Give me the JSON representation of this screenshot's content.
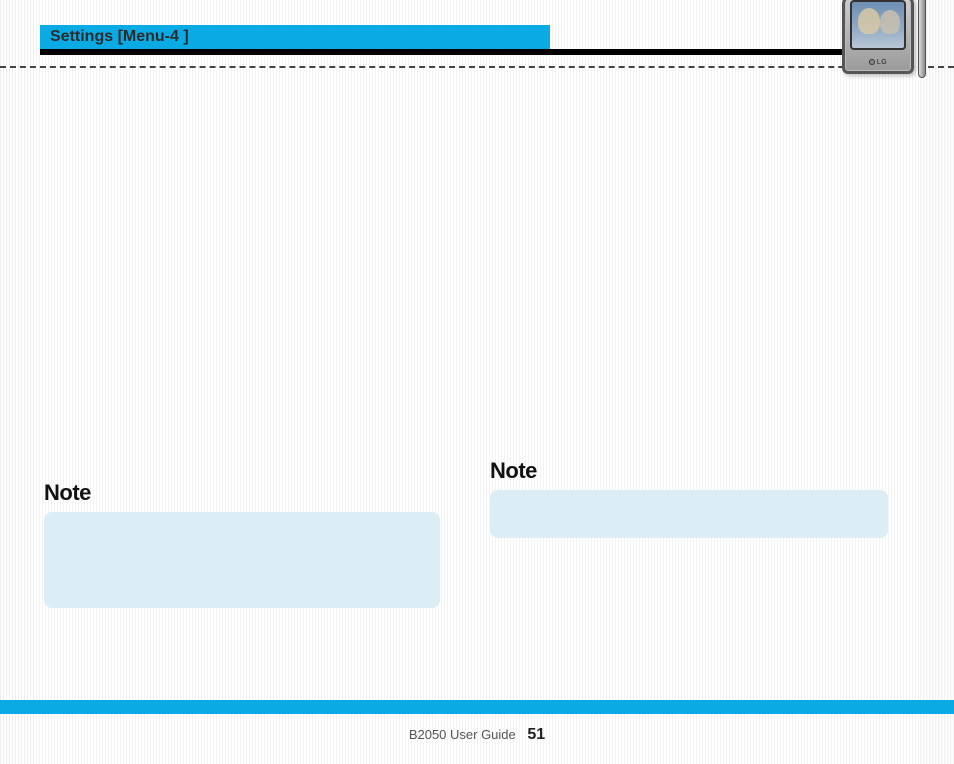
{
  "header": {
    "title": "Settings [Menu-4 ]"
  },
  "phone": {
    "brand_label": "LG"
  },
  "notes": {
    "left": {
      "label": "Note"
    },
    "right": {
      "label": "Note"
    }
  },
  "footer": {
    "guide_label": "B2050 User Guide",
    "page_number": "51"
  }
}
